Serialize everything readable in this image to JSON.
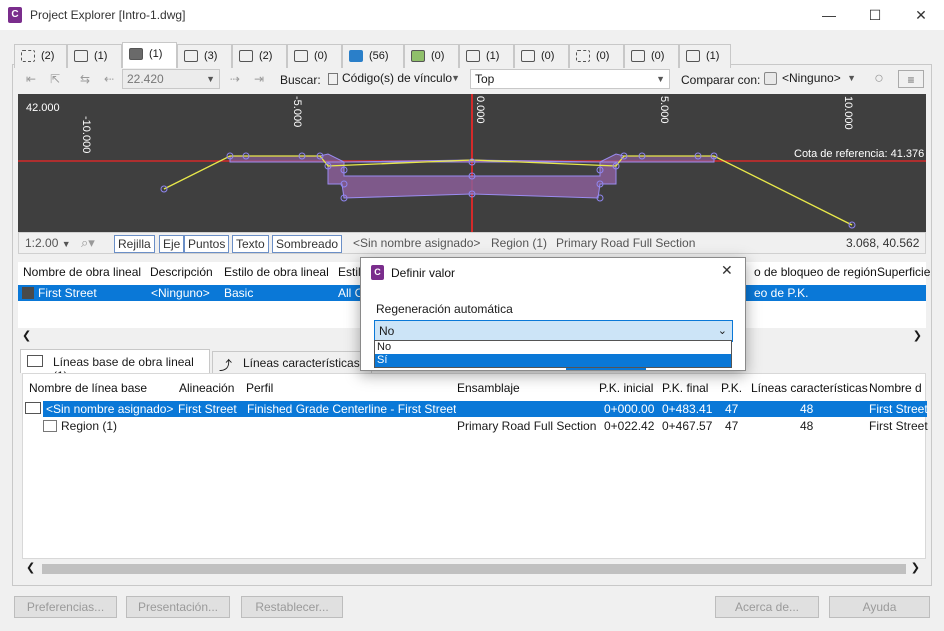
{
  "window": {
    "title": "Project Explorer [Intro-1.dwg]",
    "app_icon_letter": "C",
    "minimize": "—",
    "maximize": "☐",
    "close": "✕"
  },
  "tabs": [
    {
      "icon": "alignment-icon",
      "count": "(2)"
    },
    {
      "icon": "surface-icon",
      "count": "(1)"
    },
    {
      "icon": "corridor-icon",
      "count": "(1)",
      "active": true
    },
    {
      "icon": "assembly-icon",
      "count": "(3)"
    },
    {
      "icon": "parcel-icon",
      "count": "(2)"
    },
    {
      "icon": "feature-line-icon",
      "count": "(0)"
    },
    {
      "icon": "point-icon",
      "count": "(56)"
    },
    {
      "icon": "sample-line-icon",
      "count": "(0)"
    },
    {
      "icon": "pipe-network-icon",
      "count": "(1)"
    },
    {
      "icon": "pressure-network-icon",
      "count": "(0)"
    },
    {
      "icon": "profile-view-icon",
      "count": "(0)"
    },
    {
      "icon": "intersection-icon",
      "count": "(0)"
    },
    {
      "icon": "sheet-icon",
      "count": "(1)"
    }
  ],
  "toolbar": {
    "station_value": "22.420",
    "search_label": "Buscar:",
    "search_field": "Código(s) de vínculo",
    "search_value": "Top",
    "compare_label": "Comparar con:",
    "compare_value": "<Ninguno>"
  },
  "section_view": {
    "ref_elev_text": "Cota de referencia: 41.376",
    "y_label": "42.000",
    "x_ticks": [
      "-10.000",
      "-5.000",
      "0.000",
      "5.000",
      "10.000"
    ]
  },
  "view_status": {
    "scale": "1:2.00",
    "buttons": [
      "Rejilla",
      "Eje",
      "Puntos",
      "Texto",
      "Sombreado"
    ],
    "name": "<Sin nombre asignado>",
    "region": "Region (1)",
    "assembly": "Primary Road Full Section",
    "coords": "3.068, 40.562"
  },
  "corridor_table": {
    "headers": [
      "Nombre de obra lineal",
      "Descripción",
      "Estilo de obra lineal",
      "Estil",
      "o de bloqueo de región",
      "Superficie"
    ],
    "row": [
      "First Street",
      "<Ninguno>",
      "Basic",
      "All C",
      "eo de P.K."
    ]
  },
  "lower_tabs": [
    "Líneas base de obra lineal (1)",
    "Líneas características d"
  ],
  "baseline_table": {
    "headers": [
      "Nombre de línea base",
      "Alineación",
      "Perfil",
      "Ensamblaje",
      "P.K. inicial",
      "P.K. final",
      "P.K.",
      "Líneas características",
      "Nombre d"
    ],
    "rows": [
      [
        "<Sin nombre asignado>",
        "First Street",
        "Finished Grade Centerline - First Street",
        "",
        "0+000.00",
        "0+483.41",
        "47",
        "48",
        "First Street"
      ],
      [
        "Region (1)",
        "",
        "",
        "Primary Road Full Section",
        "0+022.42",
        "0+467.57",
        "47",
        "48",
        "First Street"
      ]
    ]
  },
  "dialog": {
    "title": "Definir valor",
    "field_label": "Regeneración automática",
    "value": "No",
    "options": [
      "No",
      "Sí"
    ],
    "highlighted": "Sí",
    "close": "✕"
  },
  "bottom_buttons": [
    "Preferencias...",
    "Presentación...",
    "Restablecer...",
    "Acerca de...",
    "Ayuda"
  ]
}
